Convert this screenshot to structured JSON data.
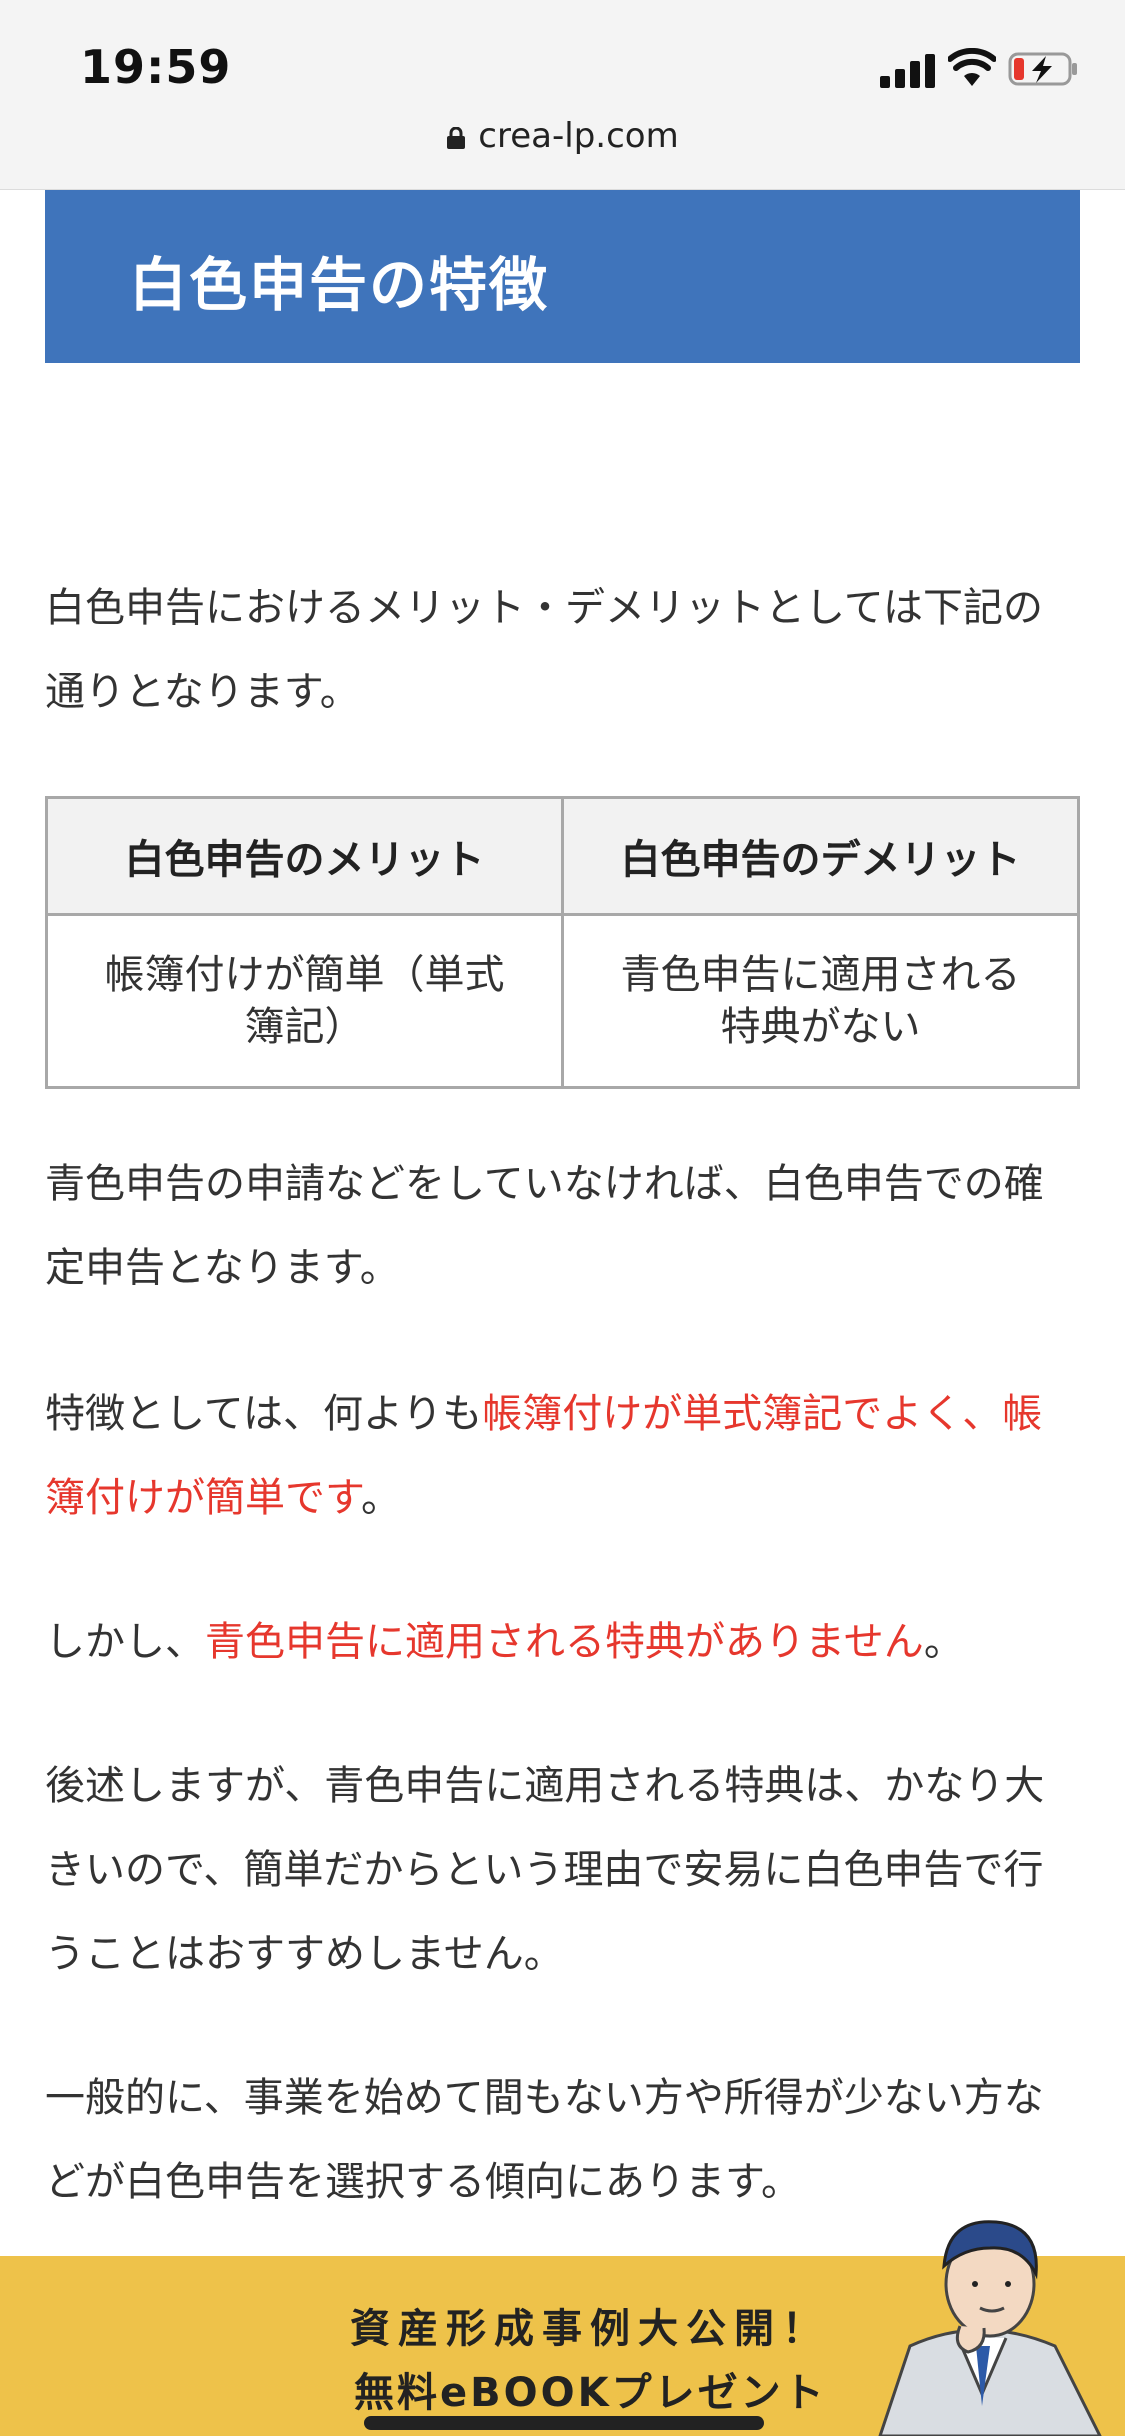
{
  "status_bar": {
    "time": "19:59",
    "url": "crea-lp.com"
  },
  "heading": {
    "title": "白色申告の特徴",
    "color": "#3f74bb"
  },
  "intro": "白色申告におけるメリット・デメリットとしては下記の通りとなります。",
  "table": {
    "headers": [
      "白色申告のメリット",
      "白色申告のデメリット"
    ],
    "rows": [
      [
        "帳簿付けが簡単（単式簿記）",
        "青色申告に適用される特典がない"
      ]
    ]
  },
  "paragraphs": {
    "p1": "青色申告の申請などをしていなければ、白色申告での確定申告となります。",
    "p2_prefix": "特徴としては、何よりも",
    "p2_highlight": "帳簿付けが単式簿記でよく、帳簿付けが簡単です",
    "p2_suffix": "。",
    "p3_prefix": "しかし、",
    "p3_highlight": "青色申告に適用される特典がありません",
    "p3_suffix": "。",
    "p4": "後述しますが、青色申告に適用される特典は、かなり大きいので、簡単だからという理由で安易に白色申告で行うことはおすすめしません。",
    "p5": "一般的に、事業を始めて間もない方や所得が少ない方などが白色申告を選択する傾向にあります。"
  },
  "highlight_color": "#e6372d",
  "ebook_banner": {
    "line1": "資産形成事例大公開！",
    "line2": "無料eBOOKプレゼント",
    "color": "#eec24a"
  }
}
